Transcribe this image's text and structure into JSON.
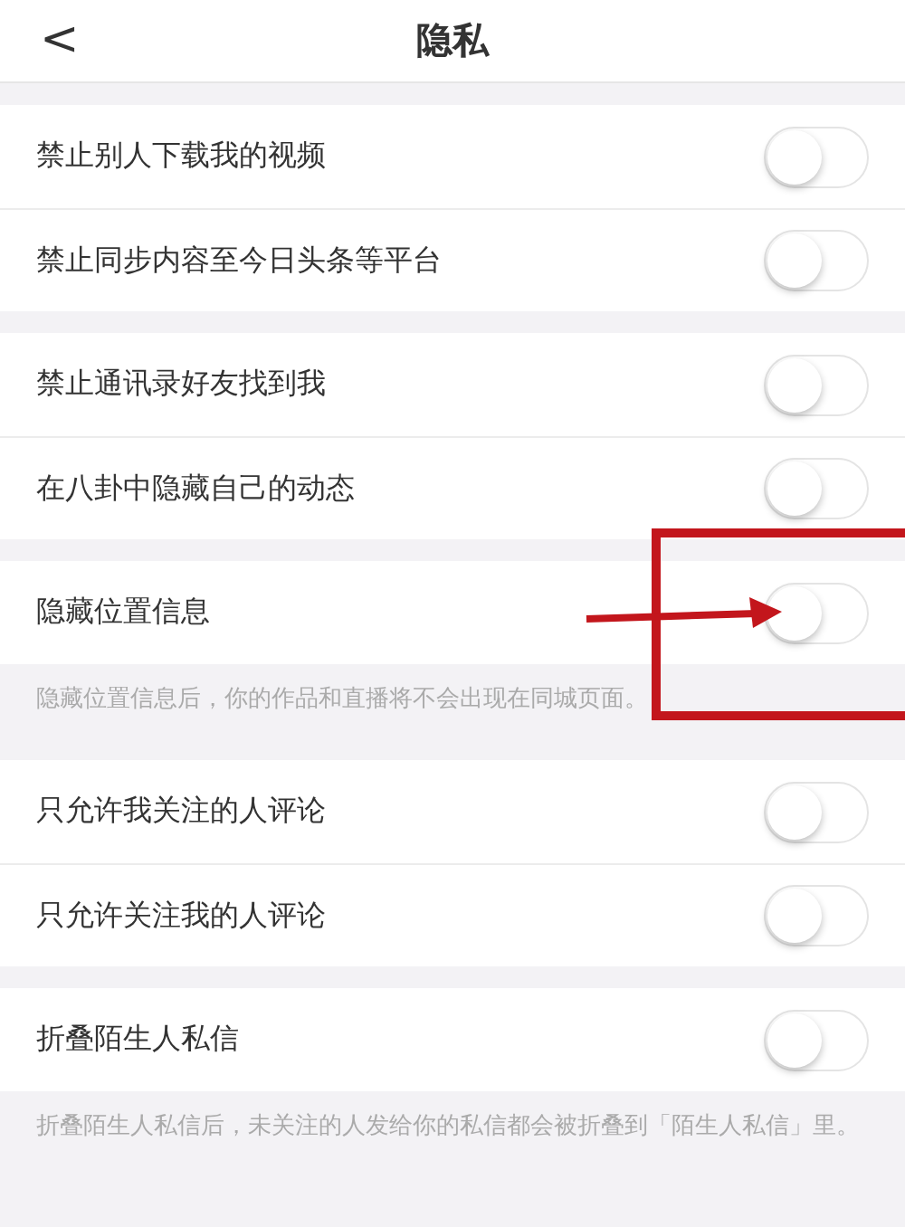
{
  "header": {
    "back": "<",
    "title": "隐私"
  },
  "groups": [
    {
      "rows": [
        {
          "label": "禁止别人下载我的视频",
          "on": false
        },
        {
          "label": "禁止同步内容至今日头条等平台",
          "on": false
        }
      ]
    },
    {
      "rows": [
        {
          "label": "禁止通讯录好友找到我",
          "on": false
        },
        {
          "label": "在八卦中隐藏自己的动态",
          "on": false
        }
      ]
    },
    {
      "rows": [
        {
          "label": "隐藏位置信息",
          "on": false
        }
      ],
      "note": "隐藏位置信息后，你的作品和直播将不会出现在同城页面。"
    },
    {
      "rows": [
        {
          "label": "只允许我关注的人评论",
          "on": false
        },
        {
          "label": "只允许关注我的人评论",
          "on": false
        }
      ]
    },
    {
      "rows": [
        {
          "label": "折叠陌生人私信",
          "on": false
        }
      ],
      "note": "折叠陌生人私信后，未关注的人发给你的私信都会被折叠到「陌生人私信」里。"
    }
  ]
}
